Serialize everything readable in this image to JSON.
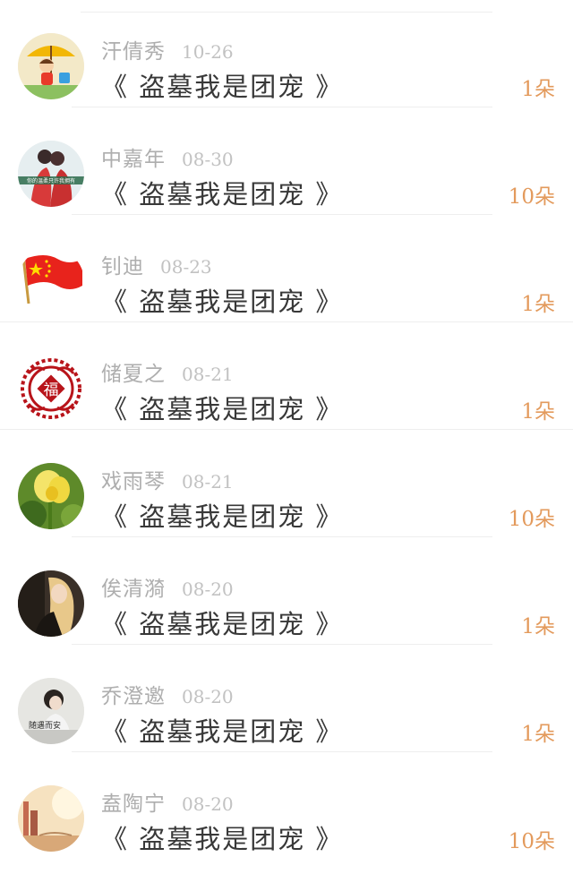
{
  "gift_list": {
    "items": [
      {
        "name": "汗倩秀",
        "date": "10-26",
        "title": "《 盗墓我是团宠 》",
        "count": "1朵",
        "avatar_icon": "cartoon-girl-umbrella-avatar"
      },
      {
        "name": "中嘉年",
        "date": "08-30",
        "title": "《 盗墓我是团宠 》",
        "count": "10朵",
        "avatar_icon": "couple-photo-avatar",
        "avatar_caption": "你的温柔只许我拥有"
      },
      {
        "name": "钊迪",
        "date": "08-23",
        "title": "《 盗墓我是团宠 》",
        "count": "1朵",
        "avatar_icon": "red-flag-avatar"
      },
      {
        "name": "储夏之",
        "date": "08-21",
        "title": "《 盗墓我是团宠 》",
        "count": "1朵",
        "avatar_icon": "fu-papercut-avatar",
        "avatar_caption": "福"
      },
      {
        "name": "戏雨琴",
        "date": "08-21",
        "title": "《 盗墓我是团宠 》",
        "count": "10朵",
        "avatar_icon": "yellow-flower-avatar"
      },
      {
        "name": "俟清漪",
        "date": "08-20",
        "title": "《 盗墓我是团宠 》",
        "count": "1朵",
        "avatar_icon": "blonde-girl-avatar"
      },
      {
        "name": "乔澄邀",
        "date": "08-20",
        "title": "《 盗墓我是团宠 》",
        "count": "1朵",
        "avatar_icon": "girl-text-avatar",
        "avatar_caption": "随遇而安"
      },
      {
        "name": "盍陶宁",
        "date": "08-20",
        "title": "《 盗墓我是团宠 》",
        "count": "10朵",
        "avatar_icon": "sunset-scene-avatar"
      }
    ]
  },
  "colors": {
    "count_orange": "#e39a5c",
    "name_gray": "#aeaeae",
    "title_dark": "#383838",
    "divider": "#eeeeee"
  }
}
